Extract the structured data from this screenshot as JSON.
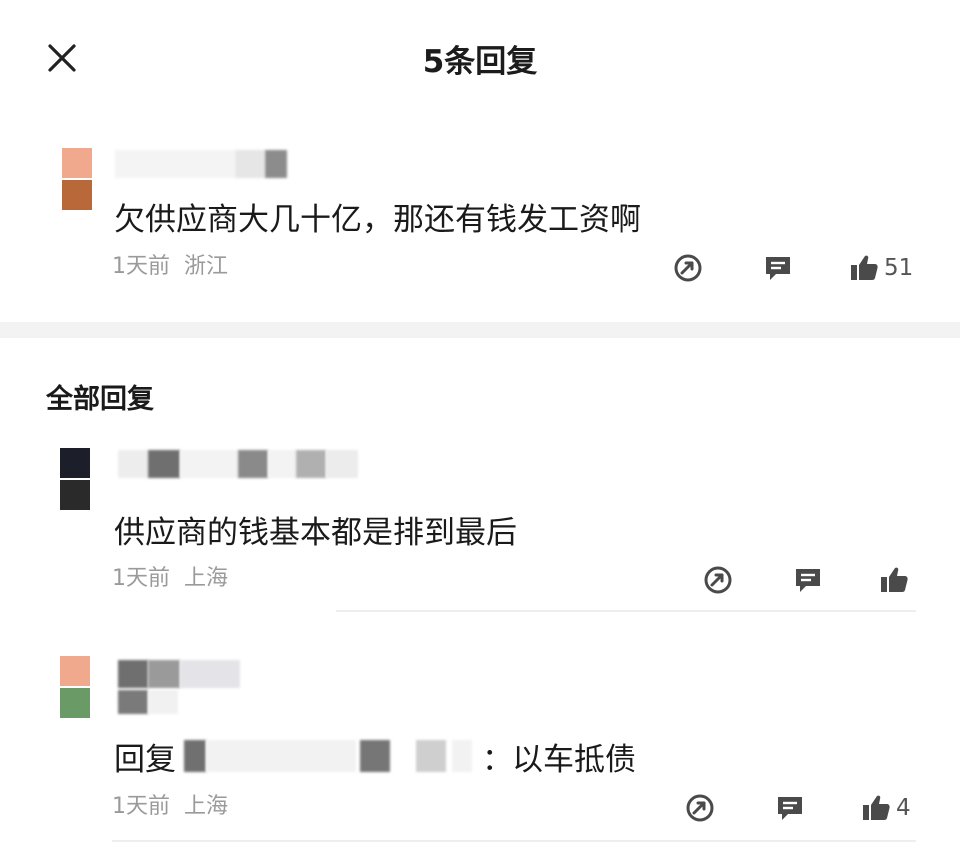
{
  "header": {
    "title": "5条回复"
  },
  "main_comment": {
    "text": "欠供应商大几十亿，那还有钱发工资啊",
    "time": "1天前",
    "location": "浙江",
    "likes": "51"
  },
  "section_title": "全部回复",
  "replies": [
    {
      "text": "供应商的钱基本都是排到最后",
      "time": "1天前",
      "location": "上海",
      "likes": ""
    },
    {
      "prefix": "回复",
      "colon": "：",
      "text": "以车抵债",
      "time": "1天前",
      "location": "上海",
      "likes": "4"
    }
  ],
  "colors": {
    "icon": "#4a4a4a",
    "meta": "#9a9a9a",
    "band": "#f3f3f3"
  }
}
